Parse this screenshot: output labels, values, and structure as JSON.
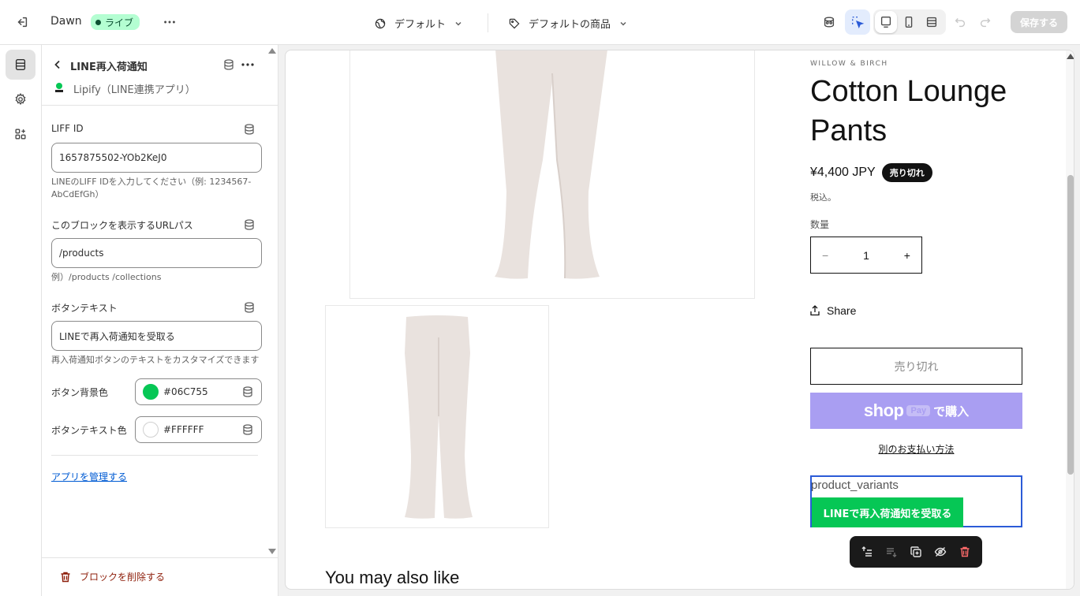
{
  "topbar": {
    "theme_name": "Dawn",
    "live_badge": "ライブ",
    "template_dropdown": "デフォルト",
    "product_dropdown": "デフォルトの商品",
    "save_label": "保存する"
  },
  "panel": {
    "title": "LINE再入荷通知",
    "app_name": "Lipify（LINE連携アプリ）",
    "liff": {
      "label": "LIFF ID",
      "value": "1657875502-YOb2KeJ0",
      "help": "LINEのLIFF IDを入力してください（例: 1234567-AbCdEfGh）"
    },
    "url_path": {
      "label": "このブロックを表示するURLパス",
      "value": "/products",
      "help": "例）/products /collections"
    },
    "button_text": {
      "label": "ボタンテキスト",
      "value": "LINEで再入荷通知を受取る",
      "help": "再入荷通知ボタンのテキストをカスタマイズできます"
    },
    "button_bg": {
      "label": "ボタン背景色",
      "value": "#06C755",
      "color": "#06C755"
    },
    "button_fg": {
      "label": "ボタンテキスト色",
      "value": "#FFFFFF",
      "color": "#FFFFFF"
    },
    "manage_link": "アプリを管理する",
    "delete_label": "ブロックを削除する"
  },
  "preview": {
    "vendor": "WILLOW & BIRCH",
    "product_title": "Cotton Lounge Pants",
    "price": "¥4,400 JPY",
    "soldout_badge": "売り切れ",
    "tax_note": "税込。",
    "quantity_label": "数量",
    "quantity_value": "1",
    "share_label": "Share",
    "soldout_button": "売り切れ",
    "shoppay_word": "shop",
    "shoppay_pay": "Pay",
    "shoppay_jp": "で購入",
    "other_payment": "別のお支払い方法",
    "app_block_name": "product_variants",
    "line_button": "LINEで再入荷通知を受取る",
    "also_like": "You may also like"
  },
  "colors": {
    "accent": "#2b5bd7",
    "live": "#b4fed2",
    "line_green": "#06C755",
    "shoppay": "#a99ef2"
  }
}
